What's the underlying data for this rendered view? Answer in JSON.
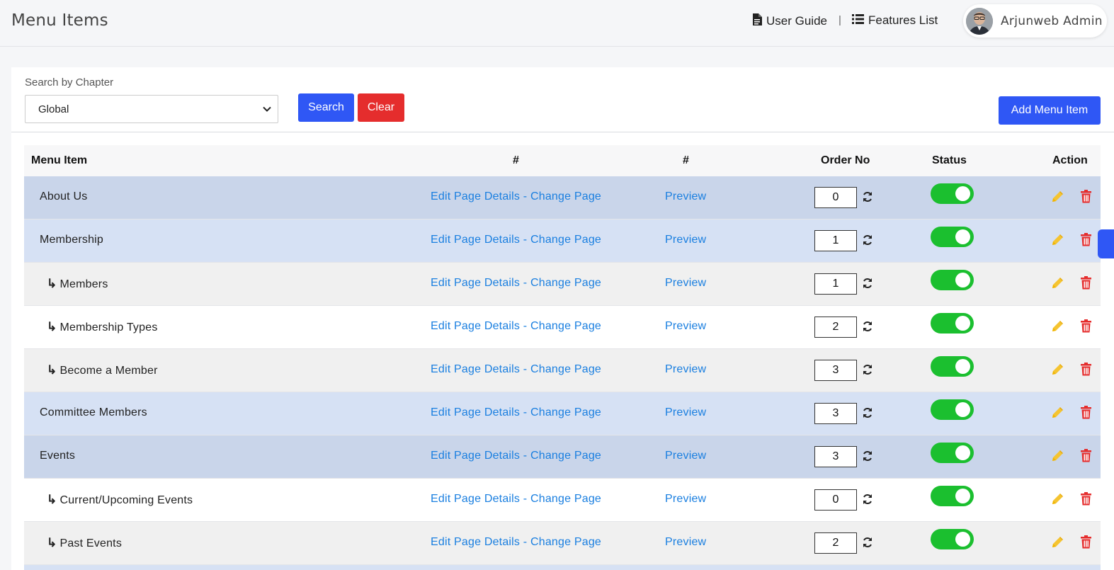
{
  "header": {
    "title": "Menu Items",
    "user_guide": "User Guide",
    "features_list": "Features List",
    "separator": "|",
    "user_name": "Arjunweb Admin"
  },
  "filter": {
    "label": "Search by Chapter",
    "selected": "Global",
    "search_label": "Search",
    "clear_label": "Clear",
    "add_label": "Add Menu Item"
  },
  "table": {
    "columns": {
      "menu_item": "Menu Item",
      "hash1": "#",
      "hash2": "#",
      "order": "Order No",
      "status": "Status",
      "action": "Action"
    },
    "edit_label": "Edit Page Details",
    "dash": " - ",
    "change_label": "Change Page",
    "preview_label": "Preview",
    "rows": [
      {
        "name": "About Us",
        "child": false,
        "order": "0",
        "enabled": true
      },
      {
        "name": "Membership",
        "child": false,
        "order": "1",
        "enabled": true
      },
      {
        "name": "Members",
        "child": true,
        "order": "1",
        "enabled": true
      },
      {
        "name": "Membership Types",
        "child": true,
        "order": "2",
        "enabled": true
      },
      {
        "name": "Become a Member",
        "child": true,
        "order": "3",
        "enabled": true
      },
      {
        "name": "Committee Members",
        "child": false,
        "order": "3",
        "enabled": true
      },
      {
        "name": "Events",
        "child": false,
        "order": "3",
        "enabled": true
      },
      {
        "name": "Current/Upcoming Events",
        "child": true,
        "order": "0",
        "enabled": true
      },
      {
        "name": "Past Events",
        "child": true,
        "order": "2",
        "enabled": true
      }
    ],
    "child_arrow": "↳"
  },
  "colors": {
    "primary": "#2f57f5",
    "danger": "#e52d2d",
    "link": "#1a7fe0",
    "toggle_on": "#1bbf2f",
    "edit_icon": "#f5c431",
    "delete_icon": "#e52d2d"
  }
}
